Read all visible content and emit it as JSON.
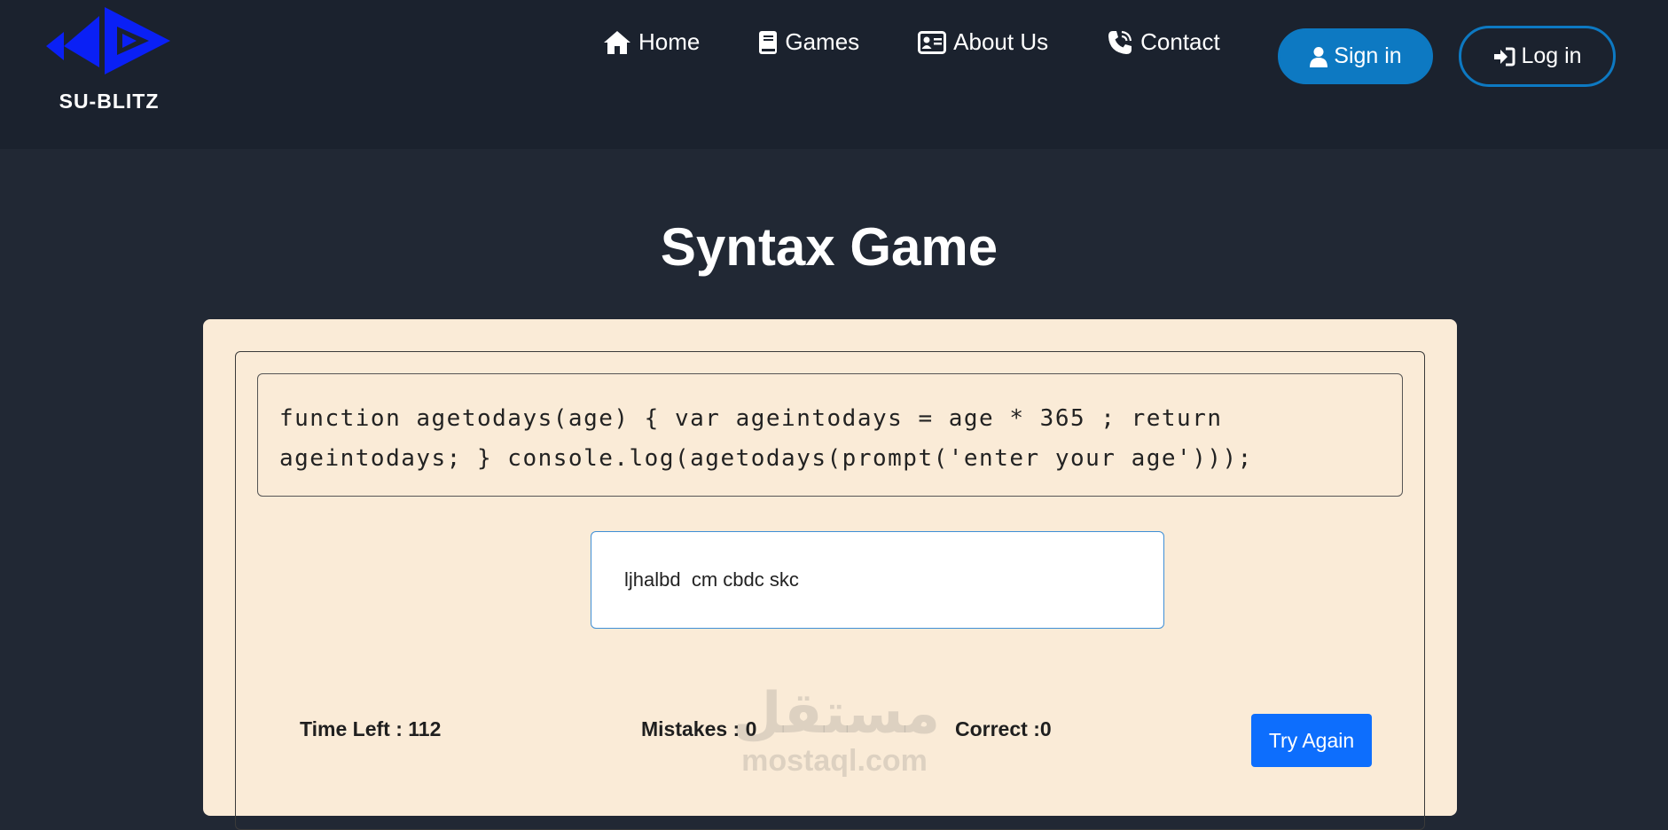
{
  "brand": {
    "name": "SU-BLITZ",
    "logo_color": "#0a20f5"
  },
  "nav": {
    "items": [
      {
        "label": "Home",
        "icon": "home-icon"
      },
      {
        "label": "Games",
        "icon": "book-icon"
      },
      {
        "label": "About Us",
        "icon": "id-card-icon"
      },
      {
        "label": "Contact",
        "icon": "phone-icon"
      }
    ],
    "signin_label": "Sign in",
    "login_label": "Log in",
    "accent_color": "#0d79c2"
  },
  "page": {
    "title": "Syntax Game"
  },
  "game": {
    "code_text": "function agetodays(age) { var ageintodays = age * 365 ; return ageintodays; } console.log(agetodays(prompt('enter your age')));",
    "input_value": "ljhalbd  cm cbdc skc",
    "time_left_label": "Time Left : ",
    "time_left_value": "112",
    "mistakes_label": "Mistakes : ",
    "mistakes_value": "0",
    "correct_label": "Correct :",
    "correct_value": "0",
    "try_again_label": "Try Again",
    "card_color": "#faebd7",
    "button_color": "#0d6efd"
  },
  "watermark": {
    "arabic": "مستقل",
    "latin": "mostaql.com"
  }
}
